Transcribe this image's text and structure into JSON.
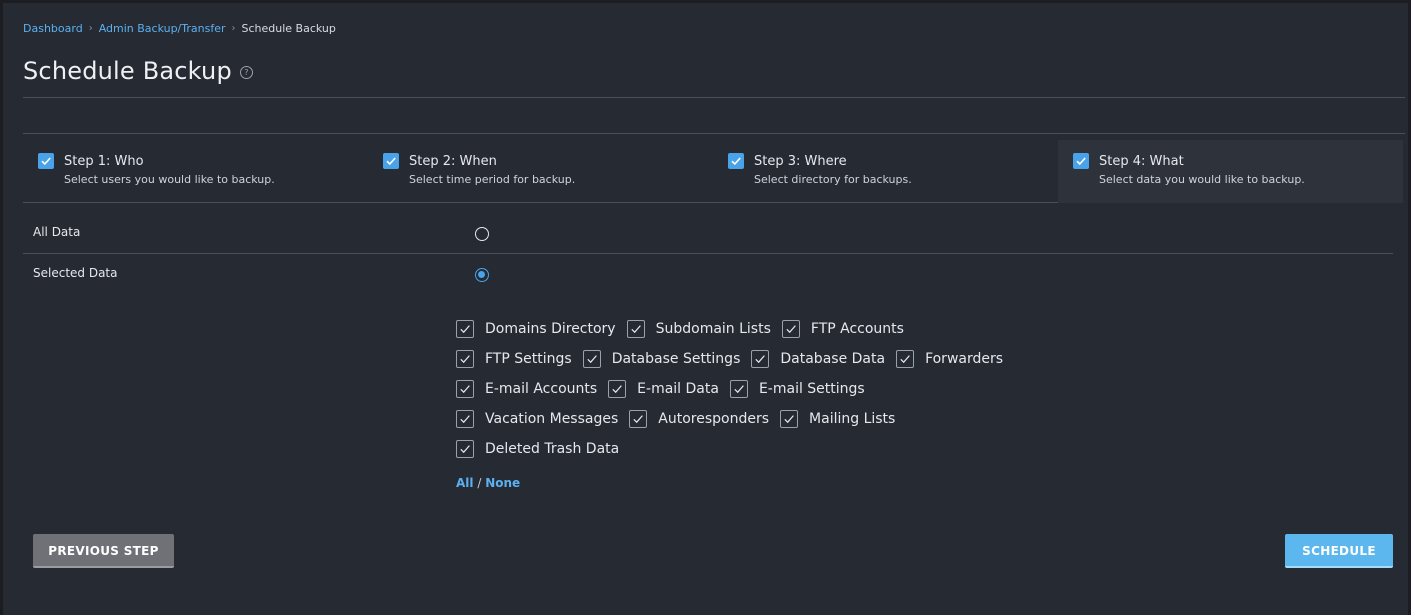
{
  "breadcrumb": {
    "items": [
      "Dashboard",
      "Admin Backup/Transfer"
    ],
    "current": "Schedule Backup"
  },
  "page": {
    "title": "Schedule Backup",
    "help_icon": "question-circle-icon"
  },
  "steps": [
    {
      "title": "Step 1: Who",
      "description": "Select users you would like to backup.",
      "checked": true,
      "active": false
    },
    {
      "title": "Step 2: When",
      "description": "Select time period for backup.",
      "checked": true,
      "active": false
    },
    {
      "title": "Step 3: Where",
      "description": "Select directory for backups.",
      "checked": true,
      "active": false
    },
    {
      "title": "Step 4: What",
      "description": "Select data you would like to backup.",
      "checked": true,
      "active": true
    }
  ],
  "options": {
    "all_data_label": "All Data",
    "selected_data_label": "Selected Data",
    "selected": "Selected Data"
  },
  "data_items": {
    "row1": [
      "Domains Directory",
      "Subdomain Lists",
      "FTP Accounts"
    ],
    "row2": [
      "FTP Settings",
      "Database Settings",
      "Database Data",
      "Forwarders"
    ],
    "row3": [
      "E-mail Accounts",
      "E-mail Data",
      "E-mail Settings"
    ],
    "row4": [
      "Vacation Messages",
      "Autoresponders",
      "Mailing Lists"
    ],
    "row5": [
      "Deleted Trash Data"
    ]
  },
  "select_links": {
    "all": "All",
    "separator": "/",
    "none": "None"
  },
  "buttons": {
    "previous": "PREVIOUS STEP",
    "schedule": "SCHEDULE"
  },
  "colors": {
    "accent": "#4aa3e8",
    "link": "#5cb0f0",
    "background": "#262a33"
  }
}
